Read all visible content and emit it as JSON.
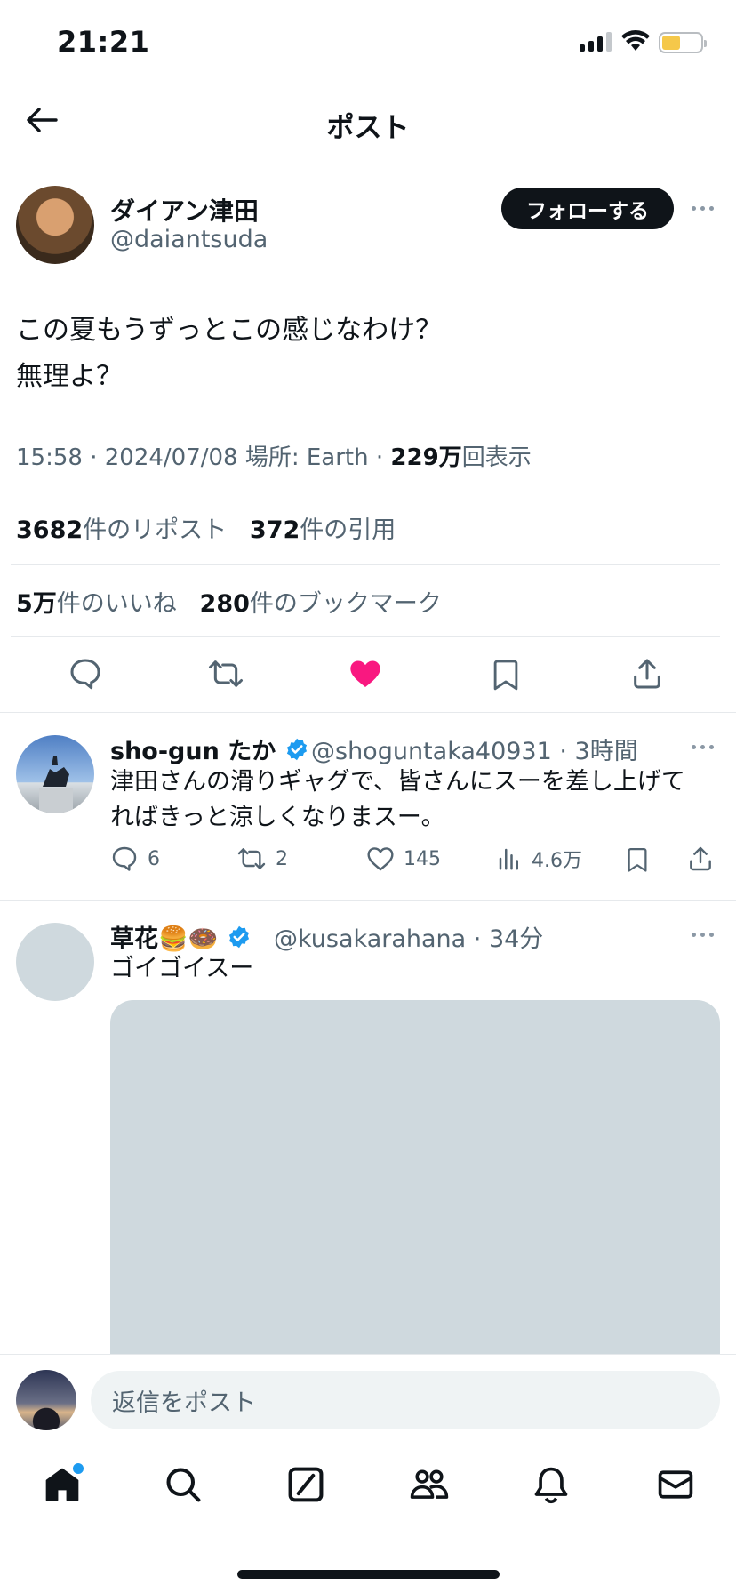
{
  "status_bar": {
    "time": "21:21"
  },
  "header": {
    "title": "ポスト"
  },
  "post": {
    "author_name": "ダイアン津田",
    "author_handle": "@daiantsuda",
    "follow_label": "フォローする",
    "text_line1": "この夏もうずっとこの感じなわけ？",
    "text_line2": "無理よ？",
    "time": "15:58",
    "date": "2024/07/08",
    "location_label": "場所: Earth",
    "views_count": "229万",
    "views_label": "回表示",
    "reposts_count": "3682",
    "reposts_label": "件のリポスト",
    "quotes_count": "372",
    "quotes_label": "件の引用",
    "likes_count": "5万",
    "likes_label": "件のいいね",
    "bookmarks_count": "280",
    "bookmarks_label": "件のブックマーク",
    "liked": true,
    "like_color": "#f91880"
  },
  "replies": [
    {
      "name": "sho-gun たか",
      "handle": "@shoguntaka40931",
      "time": "3時間",
      "text_line1": "津田さんの滑りギャグで、皆さんにスーを差し上げて",
      "text_line2": "ればきっと涼しくなりまスー。",
      "replies": "6",
      "reposts": "2",
      "likes": "145",
      "views": "4.6万"
    },
    {
      "name": "草花🍔🍩",
      "handle": "@kusakarahana",
      "time": "34分",
      "text": "ゴイゴイスー"
    }
  ],
  "composer": {
    "placeholder": "返信をポスト"
  },
  "tabbar": [
    "home-icon",
    "search-icon",
    "grok-icon",
    "communities-icon",
    "notifications-icon",
    "messages-icon"
  ],
  "colors": {
    "accent": "#1d9bf0",
    "text": "#0f1419",
    "muted": "#536471"
  }
}
